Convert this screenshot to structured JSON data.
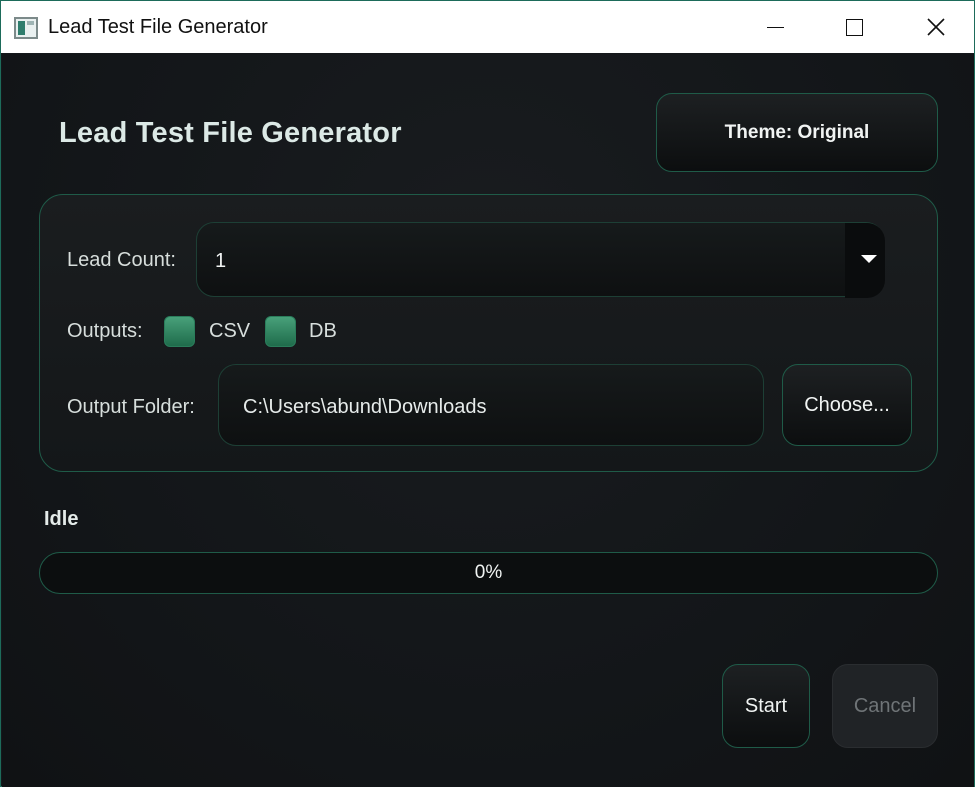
{
  "window": {
    "title": "Lead Test File Generator",
    "controls": {
      "minimize": "minimize",
      "maximize": "maximize",
      "close": "close"
    }
  },
  "app": {
    "heading": "Lead Test File Generator",
    "theme_button": "Theme: Original"
  },
  "form": {
    "lead_count_label": "Lead Count:",
    "lead_count_value": "1",
    "outputs_label": "Outputs:",
    "outputs": [
      {
        "label": "CSV",
        "checked": true
      },
      {
        "label": "DB",
        "checked": true
      }
    ],
    "output_folder_label": "Output Folder:",
    "output_folder_value": "C:\\Users\\abund\\Downloads",
    "choose_button": "Choose..."
  },
  "status": {
    "text": "Idle",
    "progress_percent": 0,
    "progress_label": "0%"
  },
  "actions": {
    "start": "Start",
    "cancel": "Cancel",
    "cancel_enabled": false
  },
  "colors": {
    "accent": "#2a8a64",
    "border_accent": "#1f5b48",
    "background": "#15181b"
  }
}
